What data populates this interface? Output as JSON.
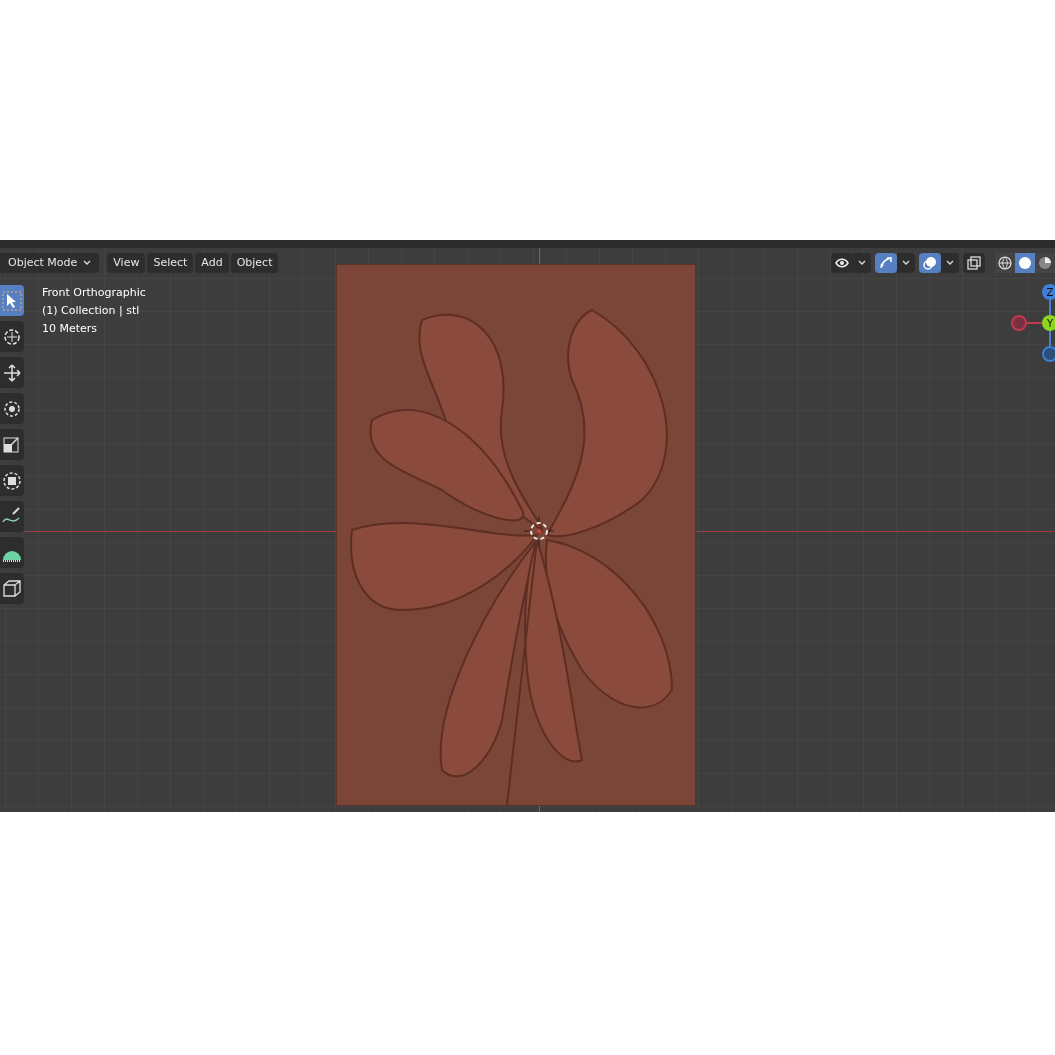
{
  "header": {
    "mode": "Object Mode",
    "menus": [
      "View",
      "Select",
      "Add",
      "Object"
    ],
    "toggles": [
      {
        "kind": "visibility",
        "on": false
      },
      {
        "kind": "gizmo",
        "on": true
      },
      {
        "kind": "overlay",
        "on": true
      },
      {
        "kind": "xray",
        "on": false
      }
    ],
    "shading": [
      {
        "kind": "wireframe",
        "selected": false
      },
      {
        "kind": "solid",
        "selected": true
      },
      {
        "kind": "material",
        "selected": false
      }
    ]
  },
  "viewport_info": [
    "Front Orthographic",
    "(1) Collection | stl",
    "10 Meters"
  ],
  "toolbar": [
    {
      "kind": "select",
      "selected": true
    },
    {
      "kind": "cursor",
      "selected": false
    },
    {
      "kind": "move",
      "selected": false
    },
    {
      "kind": "rotate",
      "selected": false
    },
    {
      "kind": "scale",
      "selected": false
    },
    {
      "kind": "transform",
      "selected": false
    },
    {
      "kind": "annotate",
      "selected": false
    },
    {
      "kind": "measure",
      "selected": false
    },
    {
      "kind": "add-cube",
      "selected": false
    }
  ],
  "gizmo": [
    {
      "label": "Z",
      "kind": "axis"
    },
    {
      "label": "Y",
      "kind": "axis"
    },
    {
      "kind": "negative"
    },
    {
      "kind": "negative-blue"
    }
  ]
}
